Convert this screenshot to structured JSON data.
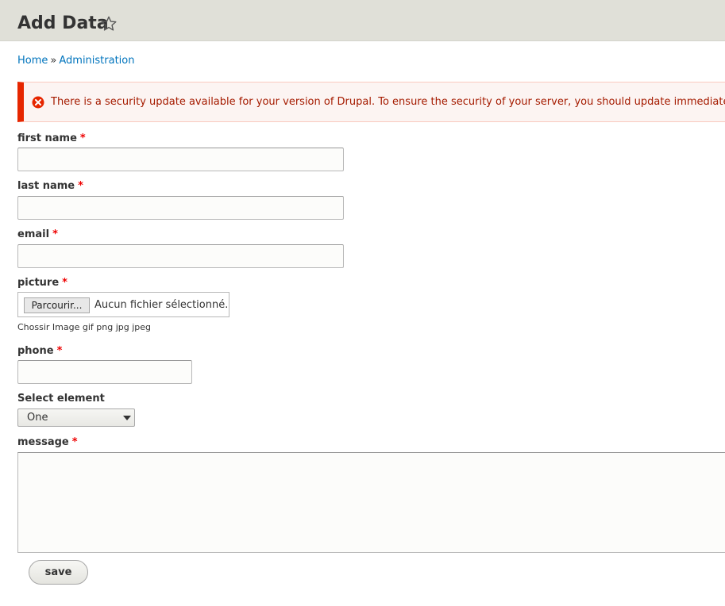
{
  "header": {
    "title": "Add Data"
  },
  "breadcrumb": {
    "home": "Home",
    "separator": "»",
    "administration": "Administration"
  },
  "message": {
    "text": "There is a security update available for your version of Drupal. To ensure the security of your server, you should update immediately! See the available updates page for more information."
  },
  "form": {
    "required_marker": "*",
    "first_name": {
      "label": "first name",
      "value": ""
    },
    "last_name": {
      "label": "last name",
      "value": ""
    },
    "email": {
      "label": "email",
      "value": ""
    },
    "picture": {
      "label": "picture",
      "button_label": "Parcourir...",
      "status": "Aucun fichier sélectionné.",
      "description": "Chossir Image gif png jpg jpeg"
    },
    "phone": {
      "label": "phone",
      "value": ""
    },
    "select": {
      "label": "Select element",
      "selected": "One"
    },
    "message": {
      "label": "message",
      "value": ""
    },
    "save_label": "save"
  },
  "colors": {
    "link": "#0074bd",
    "error_border": "#e62600",
    "error_text": "#a51b00",
    "required": "#e00000"
  }
}
